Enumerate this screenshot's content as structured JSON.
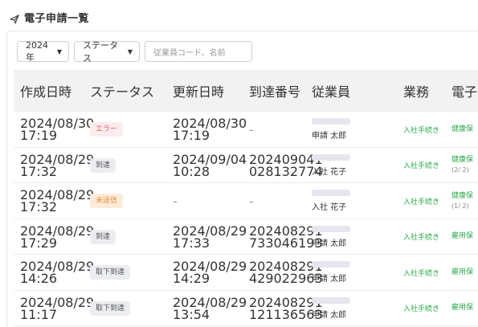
{
  "header": {
    "title": "電子申請一覧"
  },
  "filters": {
    "year_label": "2024年",
    "status_label": "ステータス",
    "search_placeholder": "従業員コード、名前"
  },
  "table": {
    "columns": [
      "作成日時",
      "ステータス",
      "更新日時",
      "到達番号",
      "従業員",
      "業務",
      "電子申"
    ],
    "rows": [
      {
        "created_date": "2024/08/30",
        "created_time": "17:19",
        "status": "エラー",
        "status_type": "error",
        "updated_date": "2024/08/30",
        "updated_time": "17:19",
        "arrival_1": "-",
        "arrival_2": "",
        "employee": "申請 太郎",
        "work": "入社手続き",
        "elec": "健康保",
        "elec_sub": ""
      },
      {
        "created_date": "2024/08/29",
        "created_time": "17:32",
        "status": "到達",
        "status_type": "neutral",
        "updated_date": "2024/09/04",
        "updated_time": "10:28",
        "arrival_1": "202409041",
        "arrival_2": "028132774",
        "employee": "入社 花子",
        "work": "入社手続き",
        "elec": "健康保",
        "elec_sub": "(2/ 2)"
      },
      {
        "created_date": "2024/08/29",
        "created_time": "17:32",
        "status": "未送信",
        "status_type": "unsent",
        "updated_date": "-",
        "updated_time": "",
        "arrival_1": "-",
        "arrival_2": "",
        "employee": "入社 花子",
        "work": "入社手続き",
        "elec": "健康保",
        "elec_sub": "(1/ 2)"
      },
      {
        "created_date": "2024/08/29",
        "created_time": "17:29",
        "status": "到達",
        "status_type": "neutral",
        "updated_date": "2024/08/29",
        "updated_time": "17:33",
        "arrival_1": "202408291",
        "arrival_2": "733046193",
        "employee": "申請 太郎",
        "work": "入社手続き",
        "elec": "雇用保",
        "elec_sub": ""
      },
      {
        "created_date": "2024/08/29",
        "created_time": "14:26",
        "status": "取下到達",
        "status_type": "neutral",
        "updated_date": "2024/08/29",
        "updated_time": "14:29",
        "arrival_1": "202408291",
        "arrival_2": "429022963",
        "employee": "申請 太郎",
        "work": "入社手続き",
        "elec": "雇用保",
        "elec_sub": ""
      },
      {
        "created_date": "2024/08/29",
        "created_time": "11:17",
        "status": "取下到達",
        "status_type": "neutral",
        "updated_date": "2024/08/29",
        "updated_time": "13:54",
        "arrival_1": "202408291",
        "arrival_2": "121136563",
        "employee": "申請 太郎",
        "work": "入社手続き",
        "elec": "雇用保",
        "elec_sub": ""
      }
    ]
  }
}
